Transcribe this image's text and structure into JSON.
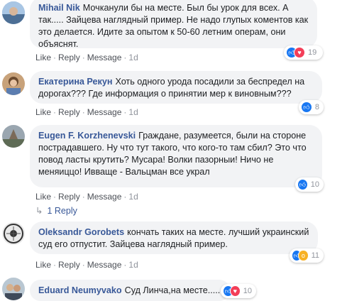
{
  "actions": {
    "like": "Like",
    "reply": "Reply",
    "message": "Message",
    "sep": "·",
    "time": "1d"
  },
  "comments": [
    {
      "author": "Mihail Nik",
      "text": "Мочканули бы на месте. Был бы урок для всех. А так..... Зайцева наглядный пример. Не надо глупых коментов как это делается. Идите за опытом к 50-60 летним операм, они объяснят.",
      "reactions": [
        "like",
        "love"
      ],
      "count": "19"
    },
    {
      "author": "Екатерина Рекун",
      "text": "Хоть одного урода посадили за беспредел на дорогах??? Где информация о принятии мер к виновным???",
      "reactions": [
        "like"
      ],
      "count": "8"
    },
    {
      "author": "Eugen F. Korzhenevski",
      "text": "Граждане, разумеется, были на стороне пострадавшего. Ну что тут такого, что кого-то там сбил? Это что повод ласты крутить? Мусара! Волки пазорныи! Ничо не меняиццо! Ивваще - Вальцман все украл",
      "reactions": [
        "like"
      ],
      "count": "10",
      "replies": "1 Reply"
    },
    {
      "author": "Oleksandr Gorobets",
      "text": "кончать таких на месте. лучший украинский суд его отпустит. Зайцева наглядный пример.",
      "reactions": [
        "like",
        "wow"
      ],
      "count": "11"
    },
    {
      "author": "Eduard Neumyvako",
      "text": "Суд Линча,на месте.....",
      "reactions": [
        "like",
        "love"
      ],
      "count": "10"
    }
  ]
}
